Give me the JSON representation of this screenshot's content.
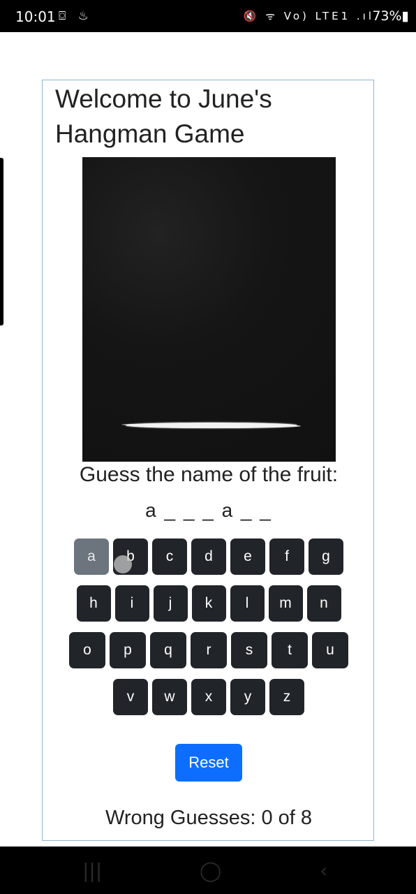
{
  "status_bar": {
    "time": "10:01",
    "left_icons": "⌼ ♨",
    "right_icons": "🔇 ᯤ Vo) LTE1 .ıl",
    "battery": "73%▮"
  },
  "game": {
    "title": "Welcome to June's Hangman Game",
    "prompt": "Guess the name of the fruit:",
    "word_display": "a _ _ _ a _ _",
    "keyboard": [
      [
        {
          "l": "a",
          "used": true
        },
        {
          "l": "b"
        },
        {
          "l": "c"
        },
        {
          "l": "d"
        },
        {
          "l": "e"
        },
        {
          "l": "f"
        },
        {
          "l": "g"
        }
      ],
      [
        {
          "l": "h"
        },
        {
          "l": "i"
        },
        {
          "l": "j"
        },
        {
          "l": "k"
        },
        {
          "l": "l"
        },
        {
          "l": "m"
        },
        {
          "l": "n"
        }
      ],
      [
        {
          "l": "o"
        },
        {
          "l": "p"
        },
        {
          "l": "q"
        },
        {
          "l": "r"
        },
        {
          "l": "s"
        },
        {
          "l": "t"
        },
        {
          "l": "u"
        }
      ],
      [
        {
          "l": "v"
        },
        {
          "l": "w"
        },
        {
          "l": "x"
        },
        {
          "l": "y"
        },
        {
          "l": "z"
        }
      ]
    ],
    "reset_label": "Reset",
    "wrong_guesses": "Wrong Guesses: 0 of 8"
  },
  "nav_bar": {
    "recent_icon": "|||",
    "home_icon": "◯",
    "back_icon": "‹"
  },
  "colors": {
    "key_bg": "#212529",
    "key_used_bg": "#6c757d",
    "reset_bg": "#0d6efd",
    "card_border": "#8fb4cf"
  }
}
